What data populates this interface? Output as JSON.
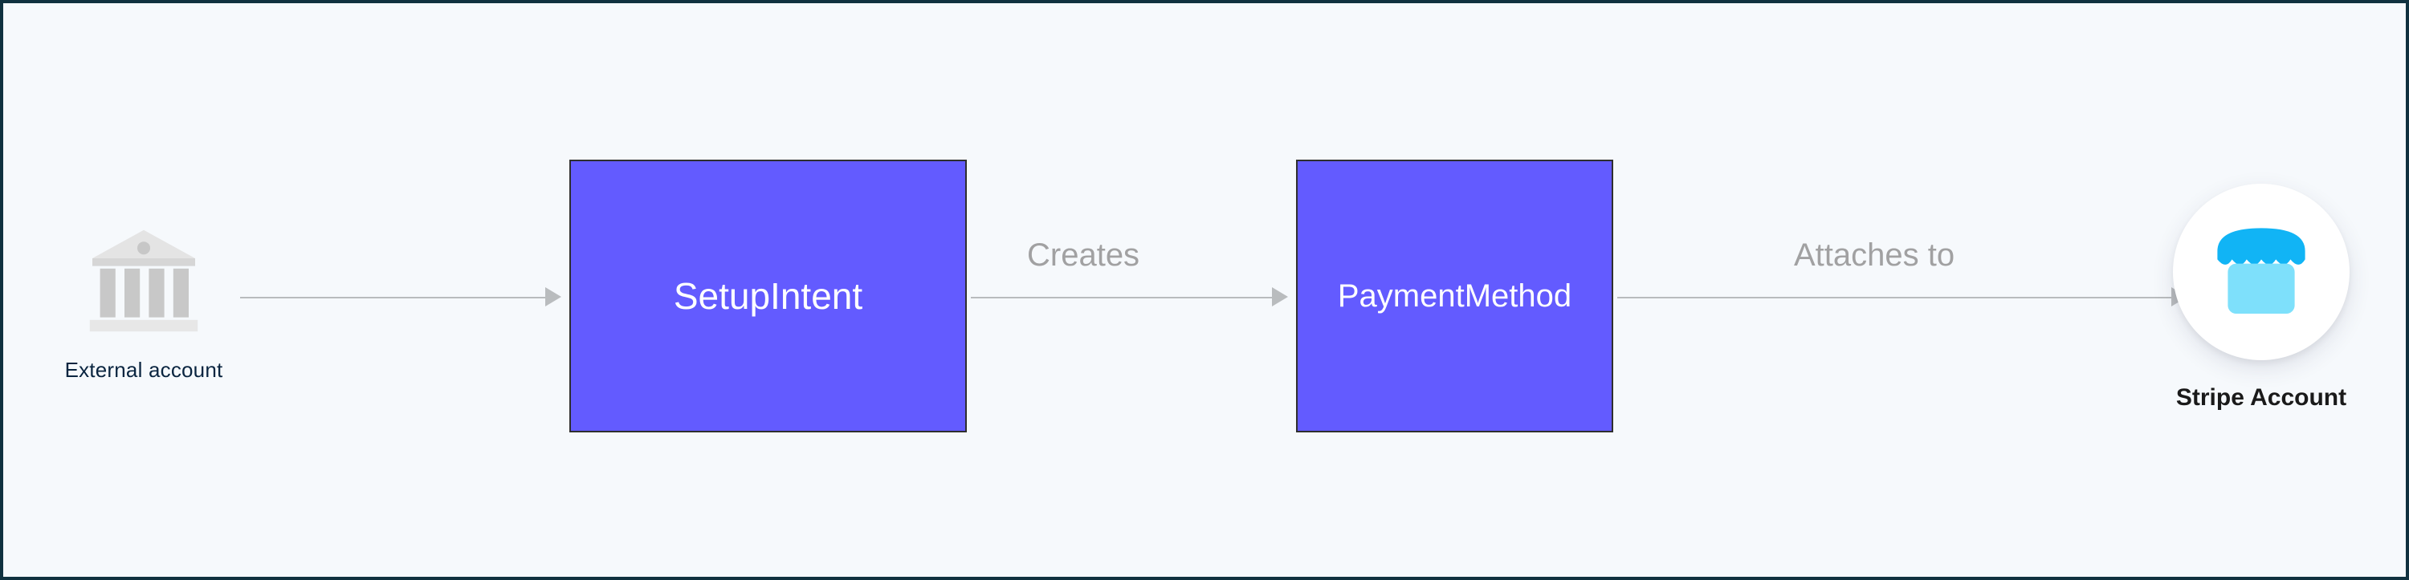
{
  "nodes": {
    "external_account": {
      "label": "External account"
    },
    "setup_intent": {
      "label": "SetupIntent"
    },
    "payment_method": {
      "label": "PaymentMethod"
    },
    "stripe_account": {
      "label": "Stripe Account"
    }
  },
  "edges": {
    "creates": {
      "label": "Creates"
    },
    "attaches": {
      "label": "Attaches to"
    }
  },
  "colors": {
    "box_fill": "#635bff",
    "panel_bg": "#f6f9fc",
    "panel_border": "#10313f",
    "arrow": "#b9bcbe",
    "label_gray": "#a1a1a2"
  }
}
